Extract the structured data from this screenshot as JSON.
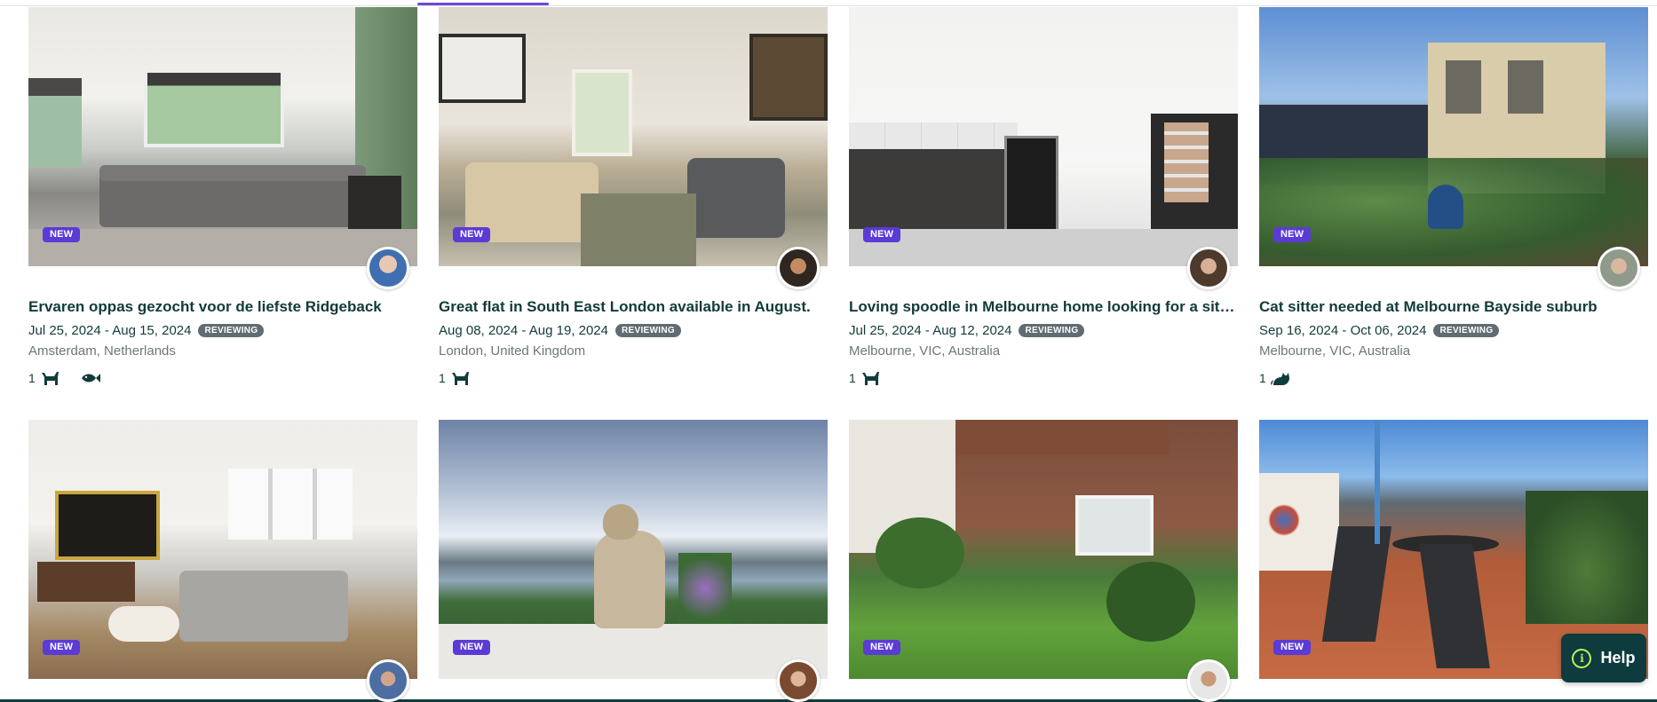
{
  "cards": [
    {
      "title": "Ervaren oppas gezocht voor de liefste Ridgeback",
      "dates": "Jul 25, 2024 - Aug 15, 2024",
      "status": "REVIEWING",
      "location": "Amsterdam, Netherlands",
      "badge": "NEW",
      "pet_count": "1",
      "pets": [
        "dog-icon",
        "fish-icon"
      ]
    },
    {
      "title": "Great flat in South East London available in August.",
      "dates": "Aug 08, 2024 - Aug 19, 2024",
      "status": "REVIEWING",
      "location": "London, United Kingdom",
      "badge": "NEW",
      "pet_count": "1",
      "pets": [
        "dog-icon"
      ]
    },
    {
      "title": "Loving spoodle in Melbourne home looking for a sitter",
      "dates": "Jul 25, 2024 - Aug 12, 2024",
      "status": "REVIEWING",
      "location": "Melbourne, VIC, Australia",
      "badge": "NEW",
      "pet_count": "1",
      "pets": [
        "dog-icon"
      ]
    },
    {
      "title": "Cat sitter needed at Melbourne Bayside suburb",
      "dates": "Sep 16, 2024 - Oct 06, 2024",
      "status": "REVIEWING",
      "location": "Melbourne, VIC, Australia",
      "badge": "NEW",
      "pet_count": "1",
      "pets": [
        "cat-icon"
      ]
    },
    {
      "badge": "NEW"
    },
    {
      "badge": "NEW"
    },
    {
      "badge": "NEW"
    },
    {
      "badge": "NEW"
    }
  ],
  "help": {
    "label": "Help"
  },
  "colors": {
    "accent": "#5b3bd6",
    "text": "#123b3b",
    "status_badge": "#616b73",
    "help_bg": "#0e3b3d"
  }
}
